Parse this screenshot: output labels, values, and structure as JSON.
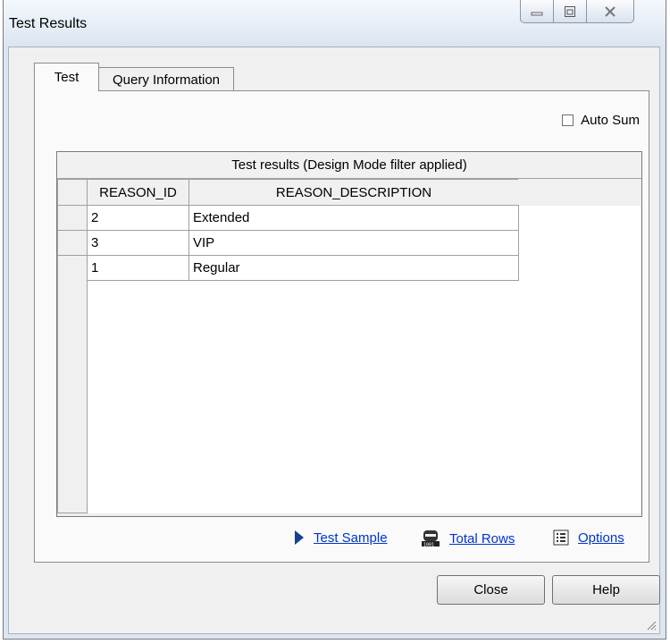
{
  "window": {
    "title": "Test Results"
  },
  "tabs": [
    {
      "label": "Test",
      "active": true
    },
    {
      "label": "Query Information",
      "active": false
    }
  ],
  "auto_sum": {
    "label": "Auto Sum",
    "checked": false
  },
  "grid": {
    "caption": "Test results (Design Mode filter applied)",
    "columns": [
      "REASON_ID",
      "REASON_DESCRIPTION"
    ],
    "rows": [
      {
        "reason_id": "2",
        "reason_description": "Extended"
      },
      {
        "reason_id": "3",
        "reason_description": "VIP"
      },
      {
        "reason_id": "1",
        "reason_description": "Regular"
      }
    ]
  },
  "actions": {
    "test_sample": "Test Sample",
    "total_rows": "Total Rows",
    "options": "Options"
  },
  "buttons": {
    "close": "Close",
    "help": "Help"
  },
  "colors": {
    "link": "#0033cc",
    "window_frame": "#dce6f2",
    "dialog": "#f0f0f0"
  },
  "icons": {
    "test_sample": "play-arrow-icon",
    "total_rows": "row-counter-icon",
    "options": "options-list-icon"
  }
}
